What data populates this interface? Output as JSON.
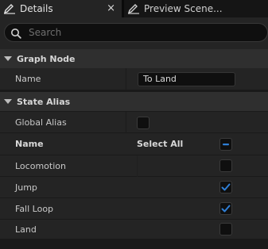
{
  "tabs": [
    {
      "label": "Details",
      "icon": "pencil-icon",
      "active": true
    },
    {
      "label": "Preview Scene...",
      "icon": "pencil-icon",
      "active": false
    }
  ],
  "close_glyph": "×",
  "search": {
    "placeholder": "Search",
    "value": ""
  },
  "graph_node": {
    "title": "Graph Node",
    "name_label": "Name",
    "name_value": "To Land"
  },
  "state_alias": {
    "title": "State Alias",
    "global_alias_label": "Global Alias",
    "global_alias_checked": false,
    "header_name": "Name",
    "header_select_all": "Select All",
    "select_all_state": "indeterminate",
    "states": [
      {
        "label": "Locomotion",
        "checked": false
      },
      {
        "label": "Jump",
        "checked": true
      },
      {
        "label": "Fall Loop",
        "checked": true
      },
      {
        "label": "Land",
        "checked": false
      }
    ]
  },
  "colors": {
    "accent": "#2f7fd6",
    "panel_bg": "#242424",
    "category_bg": "#2f2f2f",
    "field_bg": "#0f0f0f"
  }
}
